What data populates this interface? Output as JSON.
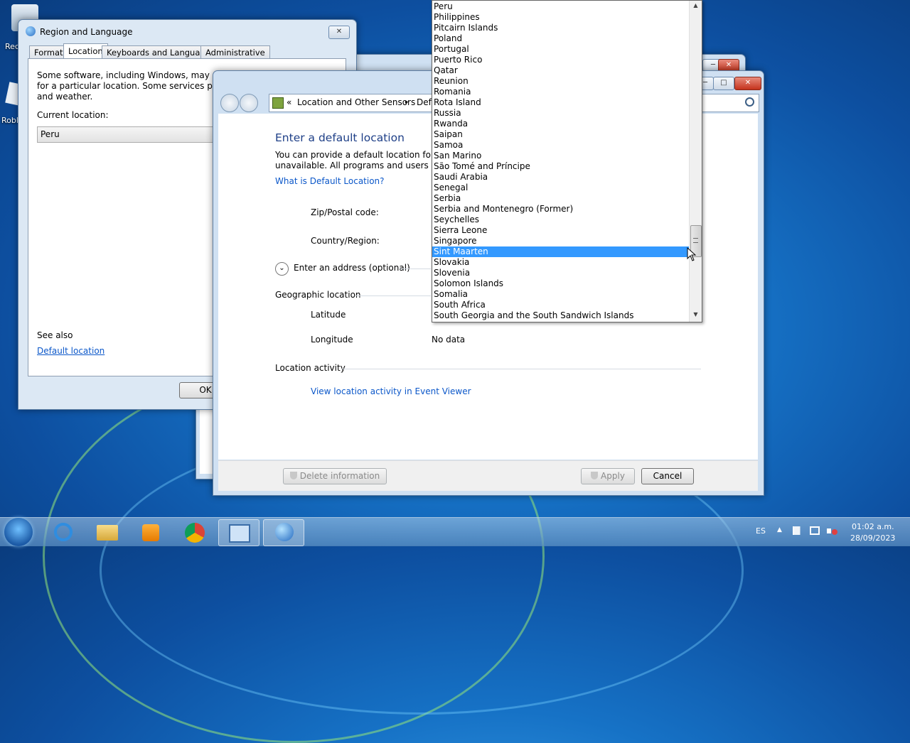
{
  "desktop": {
    "icon1_label": "Rec",
    "icon2_label": "Robl"
  },
  "region_dialog": {
    "title": "Region and Language",
    "close_glyph": "✕",
    "tabs": [
      "Formats",
      "Location",
      "Keyboards and Languages",
      "Administrative"
    ],
    "description": [
      "Some software, including Windows, may provi",
      "for a particular location. Some services provide",
      "and weather."
    ],
    "current_location_label": "Current location:",
    "current_location_value": "Peru",
    "see_also_label": "See also",
    "default_location_link": "Default location",
    "ok_label": "OK"
  },
  "sensors_window": {
    "breadcrumb": [
      "Location and Other Sensors",
      "Defa"
    ],
    "breadcrumb_prefix": "«",
    "breadcrumb_sep": "▸",
    "heading": "Enter a default location",
    "intro": [
      "You can provide a default location for pro",
      "unavailable. All programs and users on thi"
    ],
    "what_is_link": "What is Default Location?",
    "zip_label": "Zip/Postal code:",
    "country_label": "Country/Region:",
    "address_toggle": "Enter an address (optional)",
    "geo_section": "Geographic location",
    "latitude_label": "Latitude",
    "longitude_label": "Longitude",
    "longitude_value": "No data",
    "activity_section": "Location activity",
    "event_viewer_link": "View location activity in Event Viewer",
    "delete_label": "Delete information",
    "apply_label": "Apply",
    "cancel_label": "Cancel"
  },
  "country_list": {
    "items": [
      "Peru",
      "Philippines",
      "Pitcairn Islands",
      "Poland",
      "Portugal",
      "Puerto Rico",
      "Qatar",
      "Reunion",
      "Romania",
      "Rota Island",
      "Russia",
      "Rwanda",
      "Saipan",
      "Samoa",
      "San Marino",
      "São Tomé and Príncipe",
      "Saudi Arabia",
      "Senegal",
      "Serbia",
      "Serbia and Montenegro (Former)",
      "Seychelles",
      "Sierra Leone",
      "Singapore",
      "Sint Maarten",
      "Slovakia",
      "Slovenia",
      "Solomon Islands",
      "Somalia",
      "South Africa",
      "South Georgia and the South Sandwich Islands"
    ],
    "selected": "Sint Maarten"
  },
  "taskbar": {
    "language": "ES",
    "time": "01:02 a.m.",
    "date": "28/09/2023"
  },
  "colors": {
    "selection": "#3399ff",
    "link": "#0b57c9",
    "heading": "#1e3f87"
  }
}
